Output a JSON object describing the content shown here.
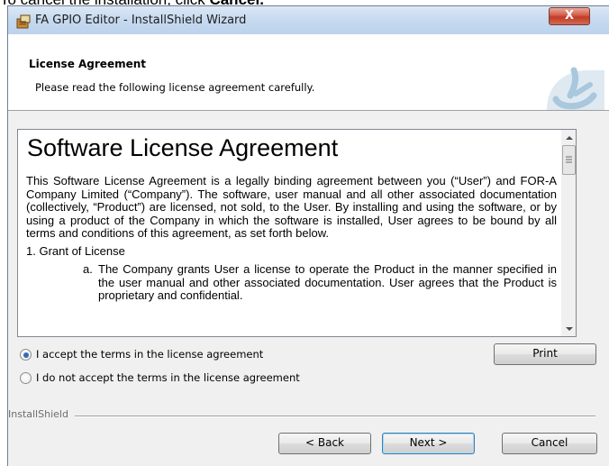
{
  "doc_caption": {
    "prefix": "To cancel the installation, click ",
    "bold": "Cancel."
  },
  "window": {
    "title": "FA GPIO Editor - InstallShield Wizard",
    "close_label": "X"
  },
  "header": {
    "title": "License Agreement",
    "subtitle": "Please read the following license agreement carefully."
  },
  "license": {
    "heading": "Software License Agreement",
    "paragraph": "This Software License Agreement is a legally binding agreement between you (“User”) and FOR-A Company Limited (“Company”). The software, user manual and all other associated documentation (collectively, “Product”) are licensed, not sold, to the User. By installing and using the software, or by using a product of the Company in which the software is installed, User agrees to be bound by all terms and conditions of this agreement, as set forth below.",
    "section_1": "1. Grant of License",
    "item_a_marker": "a.",
    "item_a": "The Company grants User a license to operate the Product in the manner specified in the user manual and other associated documentation. User agrees that the Product is proprietary and confidential."
  },
  "options": {
    "accept": "I accept the terms in the license agreement",
    "decline": "I do not accept the terms in the license agreement",
    "selected": "accept"
  },
  "buttons": {
    "print": "Print",
    "back": "< Back",
    "next": "Next >",
    "cancel": "Cancel"
  },
  "footer": {
    "brand": "InstallShield"
  },
  "icons": {
    "app": "installer-icon",
    "logo": "installshield-logo-icon"
  },
  "colors": {
    "logo_blue": "#a9c7dd",
    "radio_dot": "#2f6db8",
    "close_red": "#c23a26"
  }
}
